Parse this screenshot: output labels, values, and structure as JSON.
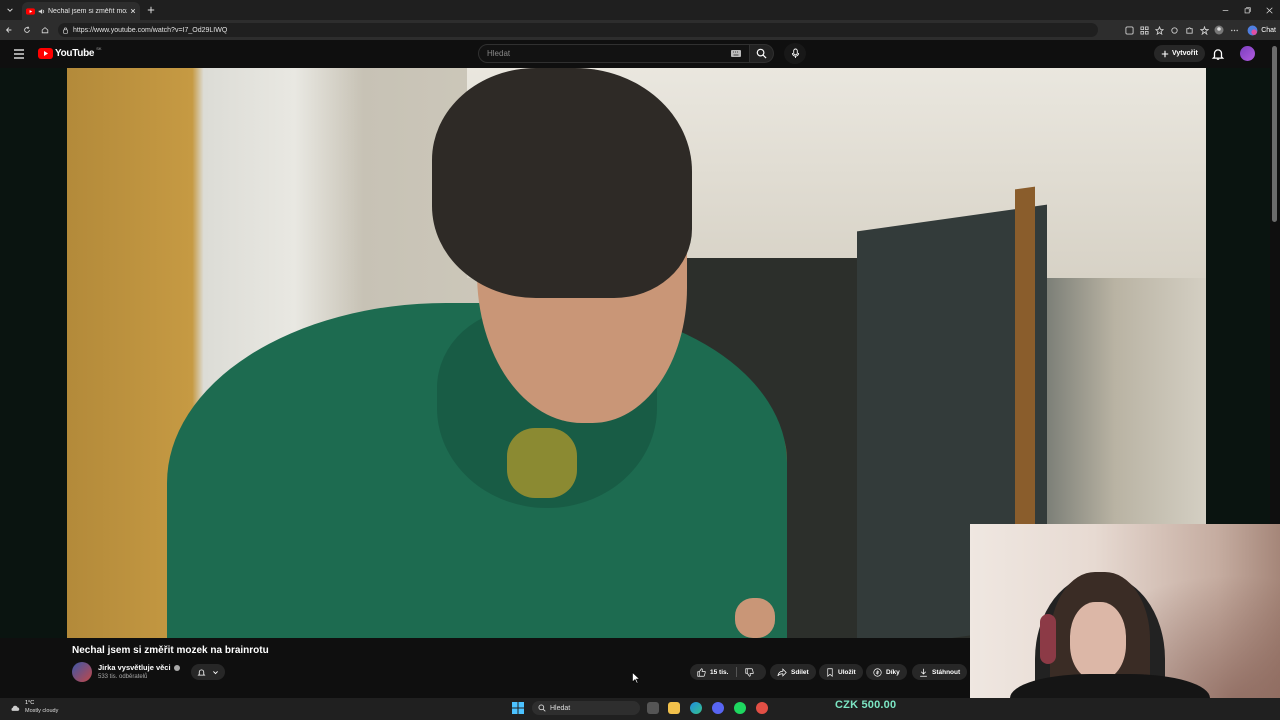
{
  "browser": {
    "tab_title": "Nechal jsem si změřit mozek",
    "url": "https://www.youtube.com/watch?v=I7_Od29LIWQ",
    "chat_label": "Chat"
  },
  "youtube": {
    "logo": "YouTube",
    "region": "SK",
    "search_placeholder": "Hledat",
    "create_label": "Vytvořit"
  },
  "video": {
    "title": "Nechal jsem si změřit mozek na brainrotu",
    "channel": "Jirka vysvětluje věci",
    "subscribers": "533 tis. odběratelů",
    "likes": "15 tis.",
    "share_label": "Sdílet",
    "save_label": "Uložit",
    "thanks_label": "Díky",
    "download_label": "Stáhnout"
  },
  "taskbar": {
    "temperature": "1°C",
    "weather": "Mostly cloudy",
    "search_label": "Hledat"
  },
  "overlay": {
    "price": "CZK 500.00"
  },
  "colors": {
    "youtube_red": "#ff0000",
    "price_green": "#7ce6c4",
    "chip_bg": "#272727"
  }
}
